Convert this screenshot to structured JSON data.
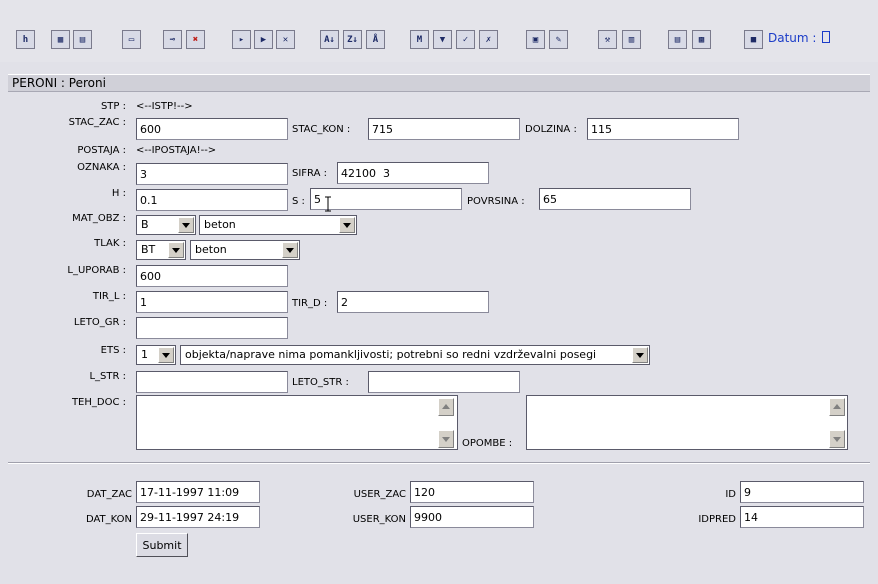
{
  "toolbar": {
    "buttons": [
      {
        "glyph": "h",
        "name": "home-icon"
      },
      {
        "glyph": "▦",
        "name": "grid-view-icon"
      },
      {
        "glyph": "▤",
        "name": "form-view-icon"
      },
      {
        "glyph": "▭",
        "name": "print-icon"
      },
      {
        "glyph": "⊸",
        "name": "key-icon"
      },
      {
        "glyph": "✖",
        "name": "delete-icon"
      },
      {
        "glyph": "▸",
        "name": "insert-record-icon"
      },
      {
        "glyph": "▶",
        "name": "next-record-icon"
      },
      {
        "glyph": "✕",
        "name": "delete-record-icon"
      },
      {
        "glyph": "A↓",
        "name": "sort-ascending-icon"
      },
      {
        "glyph": "Z↓",
        "name": "sort-descending-icon"
      },
      {
        "glyph": "Å",
        "name": "sort-clear-icon"
      },
      {
        "glyph": "M",
        "name": "find-icon"
      },
      {
        "glyph": "▼",
        "name": "filter-icon"
      },
      {
        "glyph": "✓",
        "name": "apply-filter-icon"
      },
      {
        "glyph": "✗",
        "name": "remove-filter-icon"
      },
      {
        "glyph": "▣",
        "name": "export-icon"
      },
      {
        "glyph": "✎",
        "name": "edit-icon"
      },
      {
        "glyph": "⚒",
        "name": "tools-icon"
      },
      {
        "glyph": "▥",
        "name": "report-icon"
      },
      {
        "glyph": "▤",
        "name": "list-icon"
      },
      {
        "glyph": "▩",
        "name": "users-icon"
      },
      {
        "glyph": "■",
        "name": "save-icon"
      }
    ],
    "datum_label": "Datum : "
  },
  "form_title": "PERONI : Peroni",
  "fields": {
    "stp": {
      "label": "STP :",
      "value": "<--ISTP!-->"
    },
    "stac_zac": {
      "label": "STAC_ZAC :",
      "value": "600"
    },
    "stac_kon": {
      "label": "STAC_KON :",
      "value": "715"
    },
    "dolzina": {
      "label": "DOLZINA :",
      "value": "115"
    },
    "postaja": {
      "label": "POSTAJA :",
      "value": "<--IPOSTAJA!-->"
    },
    "oznaka": {
      "label": "OZNAKA :",
      "value": "3"
    },
    "sifra": {
      "label": "SIFRA :",
      "value": "42100  3"
    },
    "h": {
      "label": "H :",
      "value": "0.1"
    },
    "s": {
      "label": "S :",
      "value": "5"
    },
    "povrsina": {
      "label": "POVRSINA :",
      "value": "65"
    },
    "mat_obz": {
      "label": "MAT_OBZ :",
      "code": "B",
      "text": "beton"
    },
    "tlak": {
      "label": "TLAK :",
      "code": "BT",
      "text": "beton"
    },
    "l_uporab": {
      "label": "L_UPORAB :",
      "value": "600"
    },
    "tir_l": {
      "label": "TIR_L :",
      "value": "1"
    },
    "tir_d": {
      "label": "TIR_D :",
      "value": "2"
    },
    "leto_gr": {
      "label": "LETO_GR :",
      "value": ""
    },
    "ets": {
      "label": "ETS :",
      "code": "1",
      "text": "objekta/naprave nima pomankljivosti; potrebni so redni vzdrževalni posegi"
    },
    "l_str": {
      "label": "L_STR :",
      "value": ""
    },
    "leto_str": {
      "label": "LETO_STR :",
      "value": ""
    },
    "teh_doc": {
      "label": "TEH_DOC :",
      "value": ""
    },
    "opombe": {
      "label": "OPOMBE :",
      "value": ""
    }
  },
  "audit": {
    "dat_zac": {
      "label": "DAT_ZAC",
      "value": "17-11-1997 11:09"
    },
    "dat_kon": {
      "label": "DAT_KON",
      "value": "29-11-1997 24:19"
    },
    "user_zac": {
      "label": "USER_ZAC",
      "value": "120"
    },
    "user_kon": {
      "label": "USER_KON",
      "value": "9900"
    },
    "id": {
      "label": "ID",
      "value": "9"
    },
    "idpred": {
      "label": "IDPRED",
      "value": "14"
    }
  },
  "submit_label": "Submit"
}
